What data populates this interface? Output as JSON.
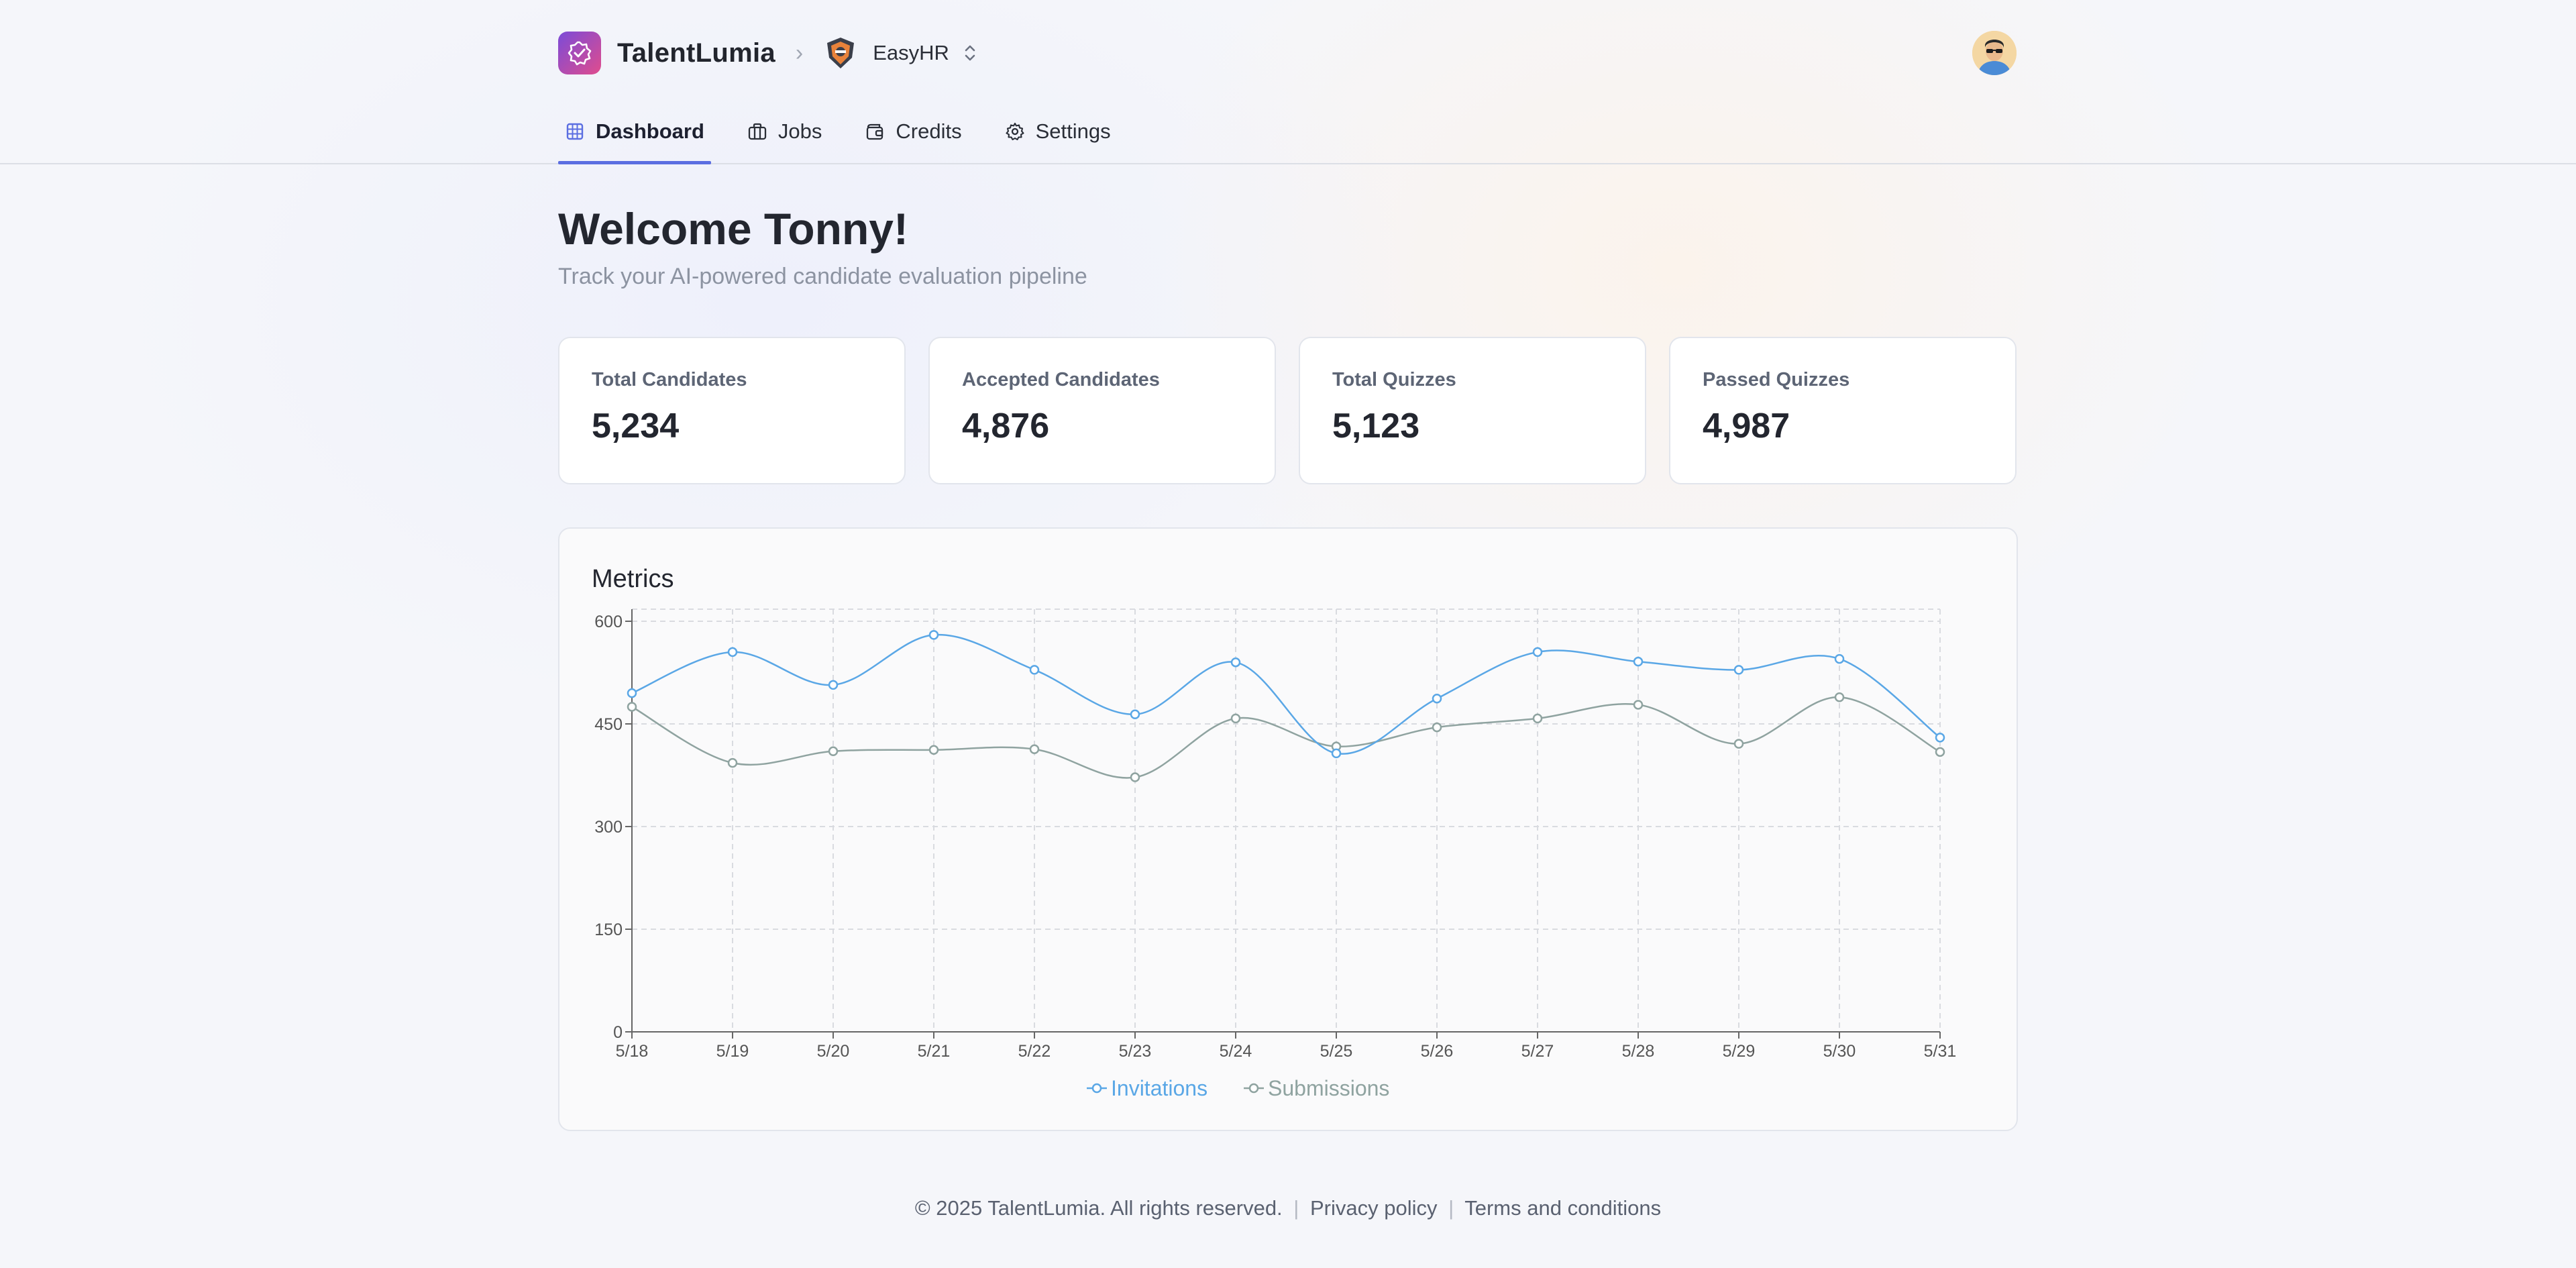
{
  "header": {
    "brand": "TalentLumia",
    "org": "EasyHR",
    "tabs": [
      {
        "label": "Dashboard",
        "active": true
      },
      {
        "label": "Jobs",
        "active": false
      },
      {
        "label": "Credits",
        "active": false
      },
      {
        "label": "Settings",
        "active": false
      }
    ]
  },
  "main": {
    "welcome": "Welcome Tonny!",
    "subtitle": "Track your AI-powered candidate evaluation pipeline",
    "cards": [
      {
        "label": "Total Candidates",
        "value": "5,234"
      },
      {
        "label": "Accepted Candidates",
        "value": "4,876"
      },
      {
        "label": "Total Quizzes",
        "value": "5,123"
      },
      {
        "label": "Passed Quizzes",
        "value": "4,987"
      }
    ],
    "metrics_title": "Metrics"
  },
  "chart_data": {
    "type": "line",
    "x": [
      "5/18",
      "5/19",
      "5/20",
      "5/21",
      "5/22",
      "5/23",
      "5/24",
      "5/25",
      "5/26",
      "5/27",
      "5/28",
      "5/29",
      "5/30",
      "5/31"
    ],
    "yticks": [
      0,
      150,
      300,
      450,
      600
    ],
    "ylim": [
      0,
      600
    ],
    "grid": true,
    "legend": "bottom",
    "series": [
      {
        "name": "Invitations",
        "color": "#5aa7e6",
        "values": [
          495,
          555,
          507,
          580,
          529,
          464,
          540,
          407,
          487,
          555,
          541,
          529,
          545,
          430
        ]
      },
      {
        "name": "Submissions",
        "color": "#8fa3a0",
        "values": [
          475,
          393,
          410,
          412,
          413,
          372,
          458,
          417,
          445,
          458,
          478,
          421,
          489,
          409
        ]
      }
    ]
  },
  "footer": {
    "copyright": "© 2025 TalentLumia. All rights reserved.",
    "privacy": "Privacy policy",
    "terms": "Terms and conditions"
  },
  "colors": {
    "accent": "#5b6ee1",
    "brand_gradient_start": "#7b4bd8",
    "brand_gradient_end": "#e04c8d"
  }
}
